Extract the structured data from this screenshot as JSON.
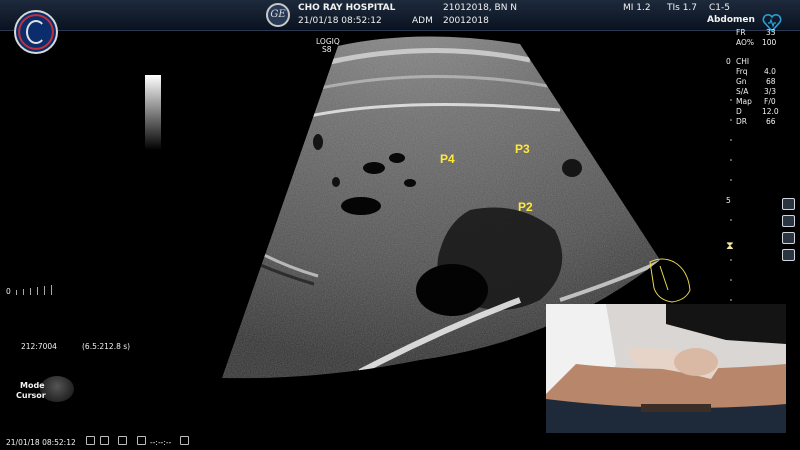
{
  "header": {
    "hospital": "CHO RAY HOSPITAL",
    "datetime": "21/01/18 08:52:12",
    "operator": "ADM",
    "patient_line": "21012018, BN N",
    "patient_id": "20012018",
    "mi": "MI 1.2",
    "tis": "TIs 1.7",
    "probe": "C1-5",
    "preset": "Abdomen",
    "fr_label": "FR",
    "fr_value": "33",
    "ao_label": "AO%",
    "ao_value": "100",
    "ge_logo_text": "GE"
  },
  "probe_marker": {
    "line1": "LOGIQ",
    "line2": "S8"
  },
  "params": {
    "depth_top": "0",
    "mode": "CHI",
    "rows": [
      {
        "label": "Frq",
        "value": "4.0"
      },
      {
        "label": "Gn",
        "value": "68"
      },
      {
        "label": "S/A",
        "value": "3/3"
      },
      {
        "label": "Map",
        "value": "F/0"
      },
      {
        "label": "D",
        "value": "12.0"
      },
      {
        "label": "DR",
        "value": "66"
      }
    ],
    "depth_mid": "5"
  },
  "labels": {
    "p4": "P4",
    "p3": "P3",
    "p2": "P2"
  },
  "left_panel": {
    "zero": "0",
    "frame_info": "212:7004",
    "time_info": "(6.5:212.8 s)",
    "mode_label": "Mode",
    "cursor_label": "Cursor"
  },
  "footer": {
    "datetime": "21/01/18 08:52:12",
    "sync": "--:--:--"
  },
  "colors": {
    "label_yellow": "#ffe93a",
    "topbar": "#0f1a2b",
    "heart": "#2a9fd6"
  },
  "icons": [
    "logo-icon",
    "ge-logo-icon",
    "heart-icon",
    "hourglass-icon",
    "image-icon",
    "bars-icon",
    "grid-icon",
    "lock-icon",
    "print-icon",
    "usb-icon"
  ]
}
